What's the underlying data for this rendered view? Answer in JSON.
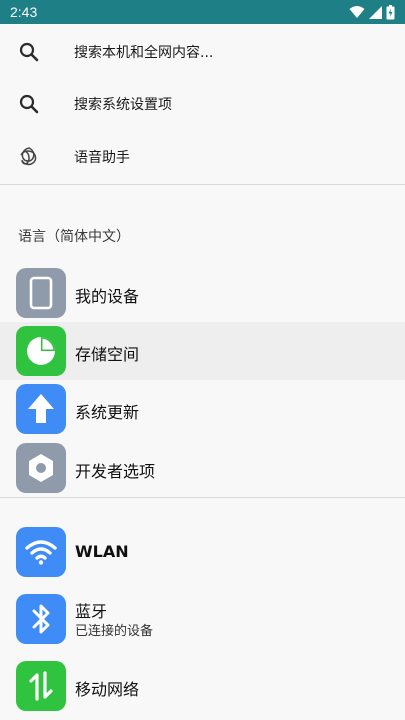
{
  "status_bar": {
    "time": "2:43",
    "icons": [
      "wifi-icon",
      "cell-signal-icon",
      "battery-charging-icon"
    ],
    "background": "#1f7f86"
  },
  "search": {
    "items": [
      {
        "label": "搜索本机和全网内容...",
        "icon": "search-icon"
      },
      {
        "label": "搜索系统设置项",
        "icon": "search-icon"
      },
      {
        "label": "语音助手",
        "icon": "voice-assistant-icon"
      }
    ]
  },
  "language": {
    "label": "语言（简体中文）"
  },
  "group1": [
    {
      "title": "我的设备",
      "icon": "phone-device-icon",
      "color": "#8f9aaa"
    },
    {
      "title": "存储空间",
      "icon": "pie-chart-icon",
      "color": "#2fc33f",
      "highlighted": true
    },
    {
      "title": "系统更新",
      "icon": "arrow-up-icon",
      "color": "#3f8cf6"
    },
    {
      "title": "开发者选项",
      "icon": "hexagon-nut-icon",
      "color": "#8f9aaa"
    }
  ],
  "group2": [
    {
      "title": "WLAN",
      "icon": "wifi-icon",
      "color": "#3f8cf6"
    },
    {
      "title": "蓝牙",
      "subtitle": "已连接的设备",
      "icon": "bluetooth-icon",
      "color": "#3f8cf6"
    },
    {
      "title": "移动网络",
      "icon": "data-arrows-icon",
      "color": "#2fc33f"
    }
  ]
}
